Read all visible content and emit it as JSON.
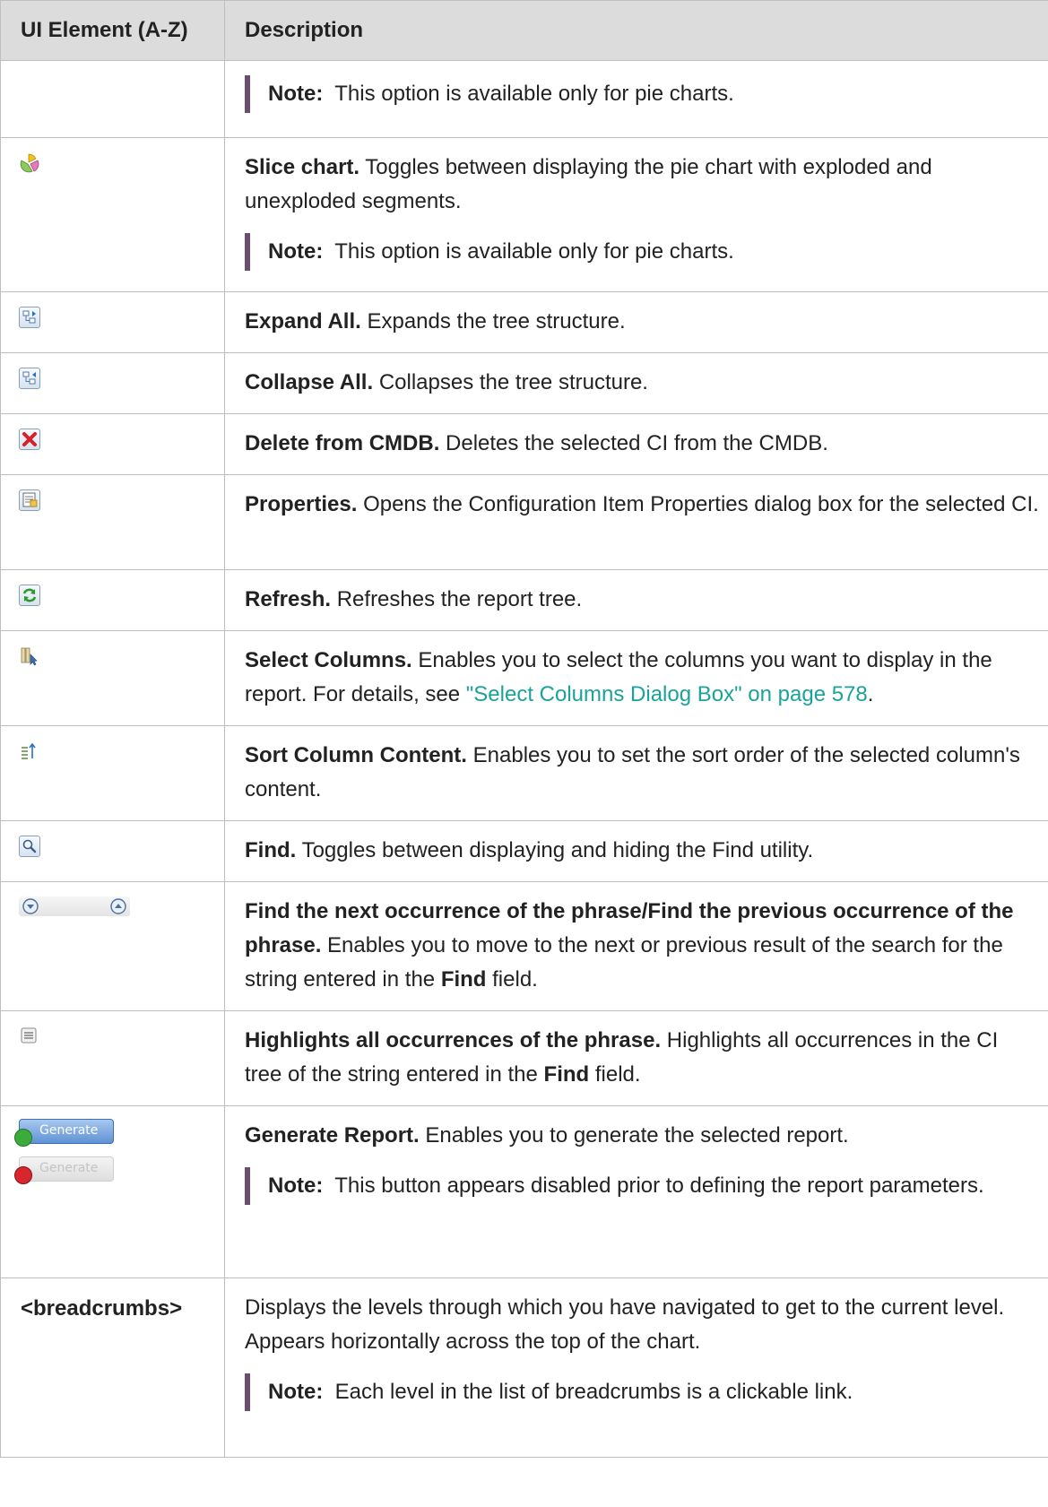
{
  "table": {
    "headers": {
      "element": "UI Element (A-Z)",
      "description": "Description"
    },
    "rows": [
      {
        "icon": null,
        "note": {
          "label": "Note:",
          "text": "This option is available only for pie charts."
        }
      },
      {
        "icon": "slice-chart-icon",
        "title": "Slice chart.",
        "text": "Toggles between displaying the pie chart with exploded and unexploded segments.",
        "note": {
          "label": "Note:",
          "text": "This option is available only for pie charts."
        }
      },
      {
        "icon": "expand-all-icon",
        "title": "Expand All.",
        "text": "Expands the tree structure."
      },
      {
        "icon": "collapse-all-icon",
        "title": "Collapse All.",
        "text": "Collapses the tree structure."
      },
      {
        "icon": "delete-icon",
        "title": "Delete from CMDB.",
        "text": "Deletes the selected CI from the CMDB."
      },
      {
        "icon": "properties-icon",
        "title": "Properties.",
        "text": "Opens the Configuration Item Properties dialog box for the selected CI."
      },
      {
        "icon": "refresh-icon",
        "title": "Refresh.",
        "text": "Refreshes the report tree."
      },
      {
        "icon": "select-columns-icon",
        "title": "Select Columns.",
        "text": "Enables you to select the columns you want to display in the report. For details, see ",
        "link": "\"Select Columns Dialog Box\" on page 578",
        "text_after": "."
      },
      {
        "icon": "sort-column-icon",
        "title": "Sort Column Content.",
        "text": "Enables you to set the sort order of the selected column's content."
      },
      {
        "icon": "find-icon",
        "title": "Find.",
        "text": "Toggles between displaying and hiding the Find utility."
      },
      {
        "icon": "find-next-prev-icons",
        "title": "Find the next occurrence of the phrase/Find the previous occurrence of the phrase.",
        "text": "Enables you to move to the next or previous result of the search for the string entered in the ",
        "bold_word": "Find",
        "text_after": " field."
      },
      {
        "icon": "highlight-all-icon",
        "title": "Highlights all occurrences of the phrase.",
        "text": "Highlights all occurrences in the CI tree of the string entered in the ",
        "bold_word": "Find",
        "text_after": " field."
      },
      {
        "icon": "generate-buttons",
        "button_label": "Generate",
        "title": "Generate Report.",
        "text": "Enables you to generate the selected report.",
        "note": {
          "label": "Note:",
          "text": "This button appears disabled prior to defining the report parameters."
        }
      },
      {
        "element_text": "<breadcrumbs>",
        "text": "Displays the levels through which you have navigated to get to the current level. Appears horizontally across the top of the chart.",
        "note": {
          "label": "Note:",
          "text": "Each level in the list of breadcrumbs is a clickable link."
        }
      }
    ]
  }
}
